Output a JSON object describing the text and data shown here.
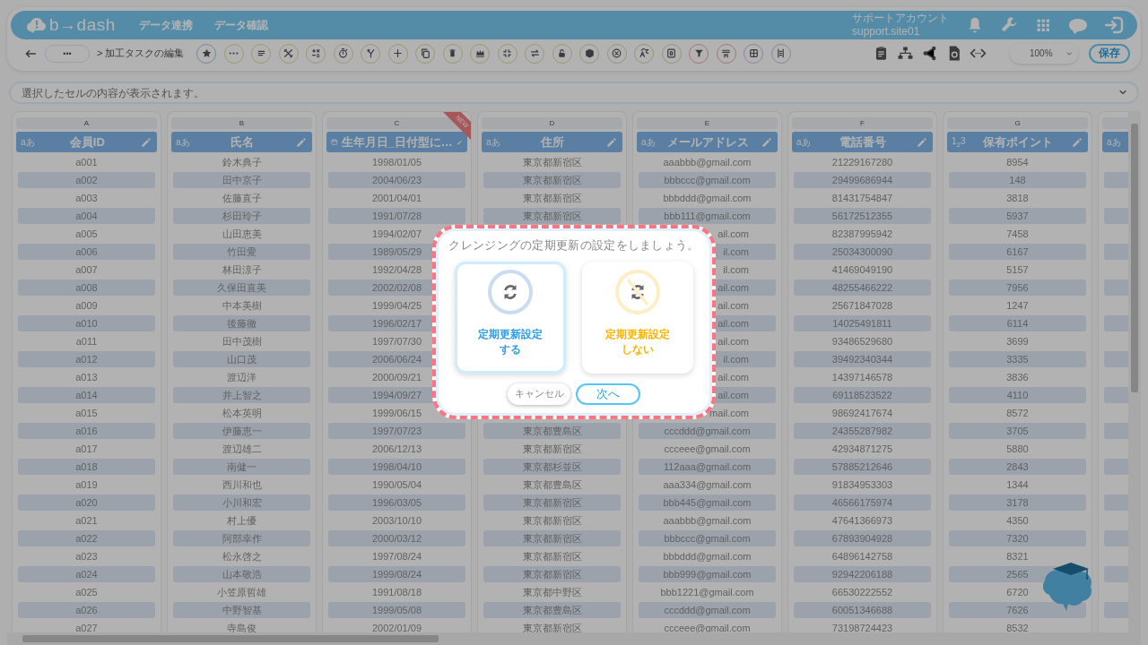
{
  "header": {
    "logo": "b→dash",
    "nav": [
      {
        "label": "データ連携"
      },
      {
        "label": "データ確認"
      }
    ],
    "account": {
      "name": "サポートアカウント",
      "id": "support.site01"
    }
  },
  "toolbar": {
    "more": "•••",
    "breadcrumb": "> 加工タスクの編集",
    "zoom": "100%",
    "save": "保存"
  },
  "cell_bar": {
    "placeholder": "選択したセルの内容が表示されます。"
  },
  "table": {
    "columns": [
      {
        "letter": "A",
        "kind": "text",
        "type_badge": "aあ",
        "label": "会員ID"
      },
      {
        "letter": "B",
        "kind": "text",
        "type_badge": "aあ",
        "label": "氏名"
      },
      {
        "letter": "C",
        "kind": "date",
        "label": "生年月日_日付型に…",
        "new_badge": "NEW"
      },
      {
        "letter": "D",
        "kind": "text",
        "type_badge": "aあ",
        "label": "住所"
      },
      {
        "letter": "E",
        "kind": "text",
        "type_badge": "aあ",
        "label": "メールアドレス"
      },
      {
        "letter": "F",
        "kind": "text",
        "type_badge": "aあ",
        "label": "電話番号"
      },
      {
        "letter": "G",
        "kind": "number",
        "type_badge": "1$_{2}$3",
        "label": "保有ポイント"
      },
      {
        "kind": "text",
        "type_badge": "aあ"
      }
    ],
    "rows": [
      {
        "covered": false,
        "cells": [
          "a001",
          "鈴木典子",
          "1998/01/05",
          "東京都新宿区",
          "aaabbb@gmail.com",
          "21229167280",
          "8954"
        ]
      },
      {
        "covered": false,
        "cells": [
          "a002",
          "田中京子",
          "2004/06/23",
          "東京都新宿区",
          "bbbccc@gmail.com",
          "29499686944",
          "148"
        ]
      },
      {
        "covered": false,
        "cells": [
          "a003",
          "佐藤直子",
          "2001/04/01",
          "東京都新宿区",
          "bbbddd@gmail.com",
          "81431754847",
          "3818"
        ]
      },
      {
        "covered": false,
        "cells": [
          "a004",
          "杉田玲子",
          "1991/07/28",
          "東京都新宿区",
          "bbb111@gmail.com",
          "56172512355",
          "5937"
        ]
      },
      {
        "covered": true,
        "cells": [
          "a005",
          "山田恵美",
          "1994/02/07",
          "ail.com",
          "82387995942",
          "7458"
        ]
      },
      {
        "covered": true,
        "cells": [
          "a006",
          "竹田愛",
          "1989/05/29",
          "il.com",
          "25034300090",
          "6167"
        ]
      },
      {
        "covered": true,
        "cells": [
          "a007",
          "林田涼子",
          "1992/04/28",
          "il.com",
          "41469049190",
          "5157"
        ]
      },
      {
        "covered": true,
        "cells": [
          "a008",
          "久保田直美",
          "2002/02/08",
          "ail.com",
          "48255466222",
          "7956"
        ]
      },
      {
        "covered": true,
        "cells": [
          "a009",
          "中本美樹",
          "1999/04/25",
          "ail.com",
          "25671847028",
          "1247"
        ]
      },
      {
        "covered": true,
        "cells": [
          "a010",
          "後藤徹",
          "1996/02/17",
          "ail.com",
          "14025491811",
          "6114"
        ]
      },
      {
        "covered": true,
        "cells": [
          "a011",
          "田中茂樹",
          "1997/07/30",
          "ail.com",
          "93486529680",
          "3699"
        ]
      },
      {
        "covered": true,
        "cells": [
          "a012",
          "山口茂",
          "2006/06/24",
          "il.com",
          "39492340344",
          "3335"
        ]
      },
      {
        "covered": true,
        "cells": [
          "a013",
          "渡辺洋",
          "2000/09/21",
          "ail.com",
          "14397146578",
          "3836"
        ]
      },
      {
        "covered": true,
        "cells": [
          "a014",
          "井上智之",
          "1994/09/27",
          "ail.com",
          "69118523522",
          "4110"
        ]
      },
      {
        "covered": true,
        "cells": [
          "a015",
          "松本英明",
          "1999/06/15",
          "mail.com",
          "98692417674",
          "8572"
        ]
      },
      {
        "covered": false,
        "cells": [
          "a016",
          "伊藤恵一",
          "1997/07/23",
          "東京都豊島区",
          "cccddd@gmail.com",
          "24355287982",
          "3705"
        ]
      },
      {
        "covered": false,
        "cells": [
          "a017",
          "渡辺雄二",
          "2006/12/13",
          "東京都新宿区",
          "ccceee@gmail.com",
          "42934871275",
          "5880"
        ]
      },
      {
        "covered": false,
        "cells": [
          "a018",
          "南健一",
          "1998/04/10",
          "東京都杉並区",
          "112aaa@gmail.com",
          "57885212646",
          "2843"
        ]
      },
      {
        "covered": false,
        "cells": [
          "a019",
          "西川和也",
          "1990/05/04",
          "東京都豊島区",
          "aaa334@gmail.com",
          "91834953303",
          "1344"
        ]
      },
      {
        "covered": false,
        "cells": [
          "a020",
          "小川和宏",
          "1996/03/05",
          "東京都新宿区",
          "bbb445@gmail.com",
          "46566175974",
          "3178"
        ]
      },
      {
        "covered": false,
        "cells": [
          "a021",
          "村上優",
          "2003/10/10",
          "東京都新宿区",
          "aaabbb@gmail.com",
          "47641366973",
          "4350"
        ]
      },
      {
        "covered": false,
        "cells": [
          "a022",
          "阿部幸作",
          "2000/03/12",
          "東京都新宿区",
          "bbbccc@gmail.com",
          "67893904928",
          "7320"
        ]
      },
      {
        "covered": false,
        "cells": [
          "a023",
          "松永啓之",
          "1997/08/24",
          "東京都新宿区",
          "bbbddd@gmail.com",
          "64896142758",
          "8321"
        ]
      },
      {
        "covered": false,
        "cells": [
          "a024",
          "山本敬浩",
          "1999/08/24",
          "東京都新宿区",
          "bbb999@gmail.com",
          "92942206188",
          "2565"
        ]
      },
      {
        "covered": false,
        "cells": [
          "a025",
          "小笠原哲雄",
          "1991/08/18",
          "東京都中野区",
          "bbb1221@gmail.com",
          "66530222552",
          "6720"
        ]
      },
      {
        "covered": false,
        "cells": [
          "a026",
          "中野智基",
          "1999/05/08",
          "東京都豊島区",
          "cccddd@gmail.com",
          "60051346688",
          "7626"
        ]
      },
      {
        "covered": false,
        "cells": [
          "a027",
          "寺島俊",
          "2002/01/09",
          "東京都新宿区",
          "ccceee@gmail.com",
          "73198724423",
          "8532"
        ]
      }
    ]
  },
  "dialog": {
    "title": "クレンジングの定期更新の設定をしましょう。",
    "options": [
      {
        "kind": "on",
        "lines": [
          "定期更新設定",
          "する"
        ],
        "selected": true
      },
      {
        "kind": "off",
        "lines": [
          "定期更新設定",
          "しない"
        ],
        "selected": false
      }
    ],
    "cancel": "キャンセル",
    "next": "次へ"
  }
}
